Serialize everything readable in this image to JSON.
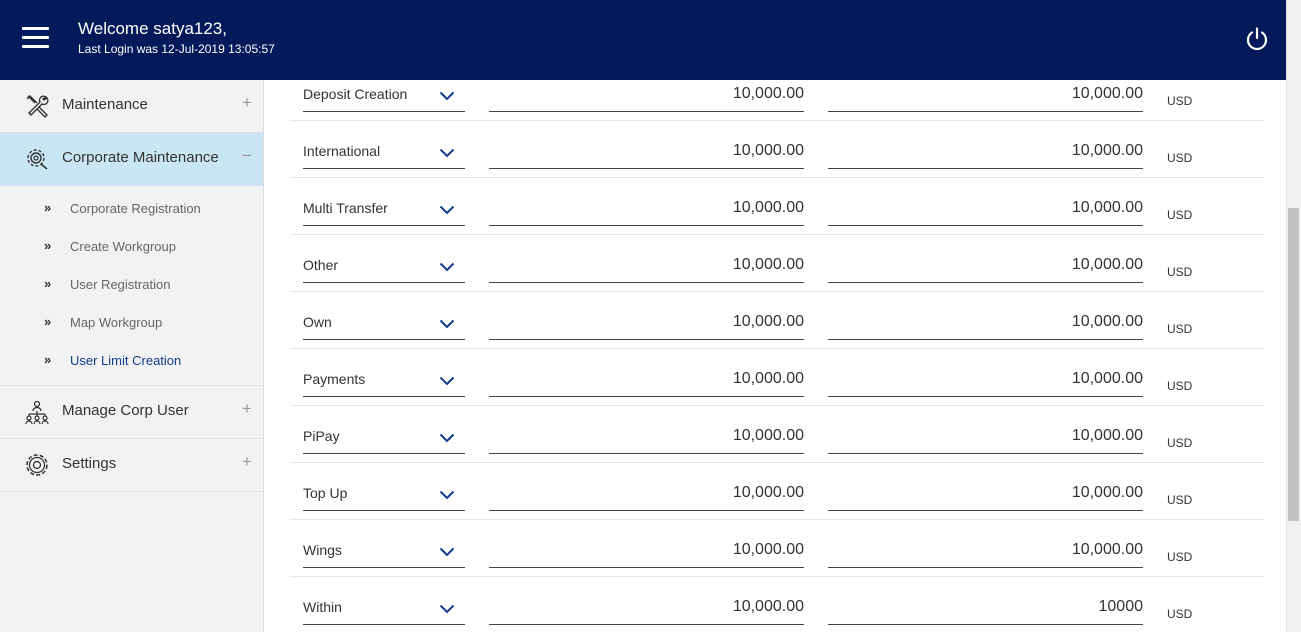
{
  "header": {
    "welcome": "Welcome satya123,",
    "last_login": "Last Login was 12-Jul-2019 13:05:57",
    "menu_icon": "hamburger-icon",
    "power_icon": "power-icon",
    "background_color": "#03195a"
  },
  "sidebar": {
    "items": [
      {
        "label": "Maintenance",
        "icon": "tools-icon",
        "toggle": "+"
      },
      {
        "label": "Corporate Maintenance",
        "icon": "gear-settings-icon",
        "toggle": "−"
      },
      {
        "label": "Manage Corp User",
        "icon": "users-hierarchy-icon",
        "toggle": "+"
      },
      {
        "label": "Settings",
        "icon": "gear-icon",
        "toggle": "+"
      }
    ],
    "sub_items": [
      {
        "label": "Corporate Registration"
      },
      {
        "label": "Create Workgroup"
      },
      {
        "label": "User Registration"
      },
      {
        "label": "Map Workgroup"
      },
      {
        "label": "User Limit Creation"
      }
    ],
    "chevron": "»",
    "active_color": "#c8e6f3"
  },
  "rows": [
    {
      "type": "Deposit Creation",
      "amount1": "10,000.00",
      "amount2": "10,000.00",
      "currency": "USD"
    },
    {
      "type": "International",
      "amount1": "10,000.00",
      "amount2": "10,000.00",
      "currency": "USD"
    },
    {
      "type": "Multi Transfer",
      "amount1": "10,000.00",
      "amount2": "10,000.00",
      "currency": "USD"
    },
    {
      "type": "Other",
      "amount1": "10,000.00",
      "amount2": "10,000.00",
      "currency": "USD"
    },
    {
      "type": "Own",
      "amount1": "10,000.00",
      "amount2": "10,000.00",
      "currency": "USD"
    },
    {
      "type": "Payments",
      "amount1": "10,000.00",
      "amount2": "10,000.00",
      "currency": "USD"
    },
    {
      "type": "PiPay",
      "amount1": "10,000.00",
      "amount2": "10,000.00",
      "currency": "USD"
    },
    {
      "type": "Top Up",
      "amount1": "10,000.00",
      "amount2": "10,000.00",
      "currency": "USD"
    },
    {
      "type": "Wings",
      "amount1": "10,000.00",
      "amount2": "10,000.00",
      "currency": "USD"
    },
    {
      "type": "Within",
      "amount1": "10,000.00",
      "amount2": "10000",
      "currency": "USD"
    }
  ]
}
